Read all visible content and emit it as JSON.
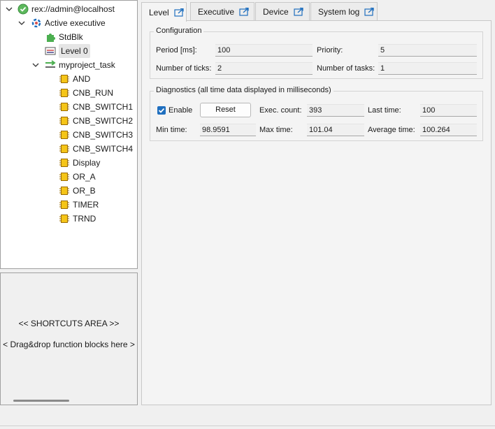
{
  "tree": {
    "connection": "rex://admin@localhost",
    "executive": "Active executive",
    "stdblk": "StdBlk",
    "level": "Level 0",
    "task": "myproject_task",
    "blocks": [
      "AND",
      "CNB_RUN",
      "CNB_SWITCH1",
      "CNB_SWITCH2",
      "CNB_SWITCH3",
      "CNB_SWITCH4",
      "Display",
      "OR_A",
      "OR_B",
      "TIMER",
      "TRND"
    ]
  },
  "shortcuts": {
    "title": "<< SHORTCUTS AREA >>",
    "hint": "< Drag&drop function blocks here >"
  },
  "tabs": [
    {
      "label": "Level",
      "active": true
    },
    {
      "label": "Executive",
      "active": false
    },
    {
      "label": "Device",
      "active": false
    },
    {
      "label": "System log",
      "active": false
    }
  ],
  "configuration": {
    "title": "Configuration",
    "period_label": "Period [ms]:",
    "period_value": "100",
    "priority_label": "Priority:",
    "priority_value": "5",
    "ticks_label": "Number of ticks:",
    "ticks_value": "2",
    "tasks_label": "Number of tasks:",
    "tasks_value": "1"
  },
  "diagnostics": {
    "title": "Diagnostics (all time data displayed in milliseconds)",
    "enable_label": "Enable",
    "enable_checked": true,
    "reset_label": "Reset",
    "exec_count_label": "Exec. count:",
    "exec_count_value": "393",
    "last_time_label": "Last time:",
    "last_time_value": "100",
    "min_time_label": "Min time:",
    "min_time_value": "98.9591",
    "max_time_label": "Max time:",
    "max_time_value": "101.04",
    "avg_time_label": "Average time:",
    "avg_time_value": "100.264"
  },
  "colors": {
    "accent": "#1f6fbf",
    "connected": "#4caf50",
    "block_icon": "#e8a800"
  }
}
